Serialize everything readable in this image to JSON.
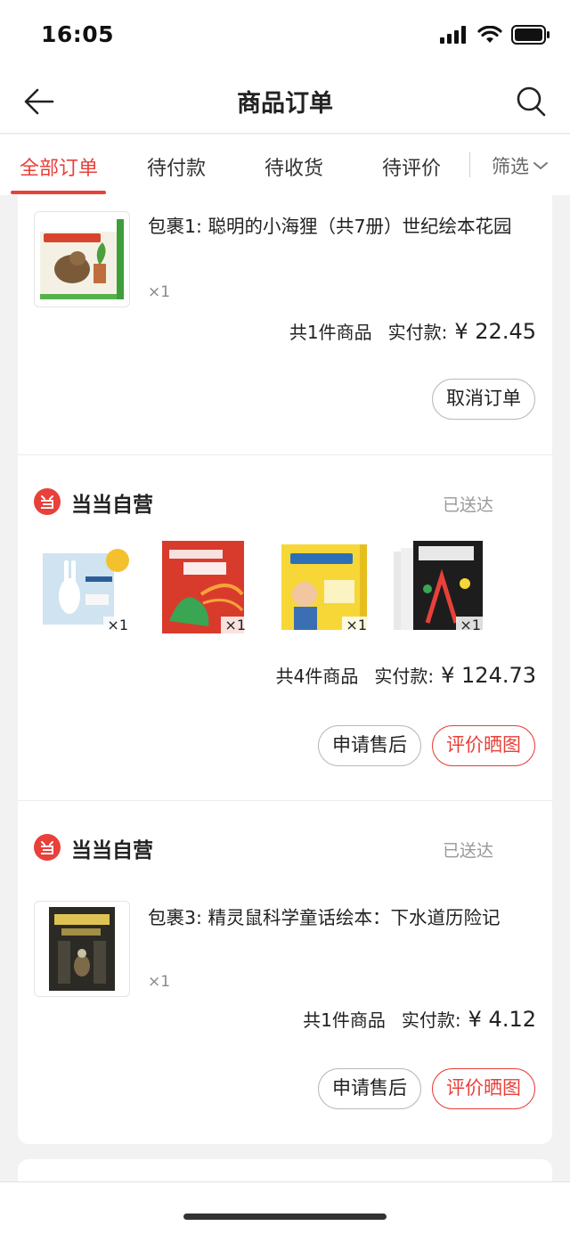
{
  "status_bar": {
    "time": "16:05"
  },
  "header": {
    "title": "商品订单"
  },
  "tabs": [
    {
      "label": "全部订单",
      "active": true
    },
    {
      "label": "待付款"
    },
    {
      "label": "待收货"
    },
    {
      "label": "待评价"
    }
  ],
  "filter": {
    "label": "筛选"
  },
  "orders": [
    {
      "item_title": "包裹1: 聪明的小海狸（共7册）世纪绘本花园",
      "quantity": "×1",
      "count_label": "共1件商品",
      "paid_label": "实付款:",
      "price": "¥ 22.45",
      "buttons": [
        "取消订单"
      ]
    },
    {
      "shop": "当当自营",
      "status": "已送达",
      "item_quantities": [
        "×1",
        "×1",
        "×1",
        "×1"
      ],
      "count_label": "共4件商品",
      "paid_label": "实付款:",
      "price": "¥ 124.73",
      "buttons": [
        "申请售后",
        "评价晒图"
      ]
    },
    {
      "shop": "当当自营",
      "status": "已送达",
      "item_title": "包裹3: 精灵鼠科学童话绘本：下水道历险记",
      "quantity": "×1",
      "count_label": "共1件商品",
      "paid_label": "实付款:",
      "price": "¥ 4.12",
      "buttons": [
        "申请售后",
        "评价晒图"
      ]
    }
  ],
  "colors": {
    "accent": "#e8403a",
    "muted": "#999999",
    "background": "#f2f2f2"
  }
}
